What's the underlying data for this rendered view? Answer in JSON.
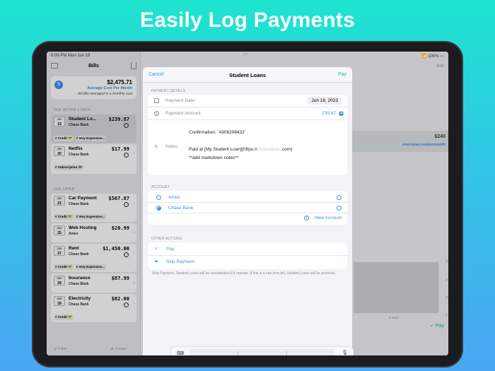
{
  "headline": "Easily Log Payments",
  "status": {
    "time": "6:09 PM",
    "date": "Mon Jun 19",
    "battery": "100%"
  },
  "sidebar": {
    "title": "Bills",
    "summary": {
      "amount": "$2,475.71",
      "caption": "Average Cost Per Month",
      "note": "All bills averaged to a monthly cost"
    },
    "sections": [
      {
        "label": "DUE WITHIN 3 DAYS",
        "bills": [
          {
            "month": "Jun",
            "day": "19",
            "name": "Student Lo...",
            "account": "Chase Bank",
            "price": "$239.87",
            "tags": [
              "# Credit 💳",
              "# Very Expensive..."
            ]
          },
          {
            "month": "Jun",
            "day": "20",
            "name": "Netflix",
            "account": "Chase Bank",
            "price": "$17.99",
            "tags": [
              "# Subscription 🎮"
            ]
          }
        ]
      },
      {
        "label": "DUE LATER",
        "bills": [
          {
            "month": "Jun",
            "day": "23",
            "name": "Car Payment",
            "account": "Chase Bank",
            "price": "$567.87",
            "tags": [
              "# Credit 💳",
              "# Very Expensive..."
            ]
          },
          {
            "month": "Jun",
            "day": "25",
            "name": "Web Hosting",
            "account": "Amex",
            "price": "$20.99",
            "tags": []
          },
          {
            "month": "Jun",
            "day": "27",
            "name": "Rent",
            "account": "Chase Bank",
            "price": "$1,450.00",
            "tags": [
              "# Credit 💳",
              "# Very Expensive..."
            ]
          },
          {
            "month": "Jun",
            "day": "29",
            "name": "Insurance",
            "account": "Chase Bank",
            "price": "$87.99",
            "tags": []
          },
          {
            "month": "Jun",
            "day": "29",
            "name": "Electricity",
            "account": "Chase Bank",
            "price": "$82.00",
            "tags": [
              "# Credit 💳"
            ]
          }
        ]
      }
    ],
    "footer": {
      "filter": "Filter",
      "create": "Create"
    }
  },
  "detail": {
    "edit": "Edit",
    "card_value": "$240",
    "card_sub": "overview.costpermonth",
    "axis": [
      "300",
      "200",
      "100",
      "0"
    ],
    "axis_date": "6-2023",
    "pay": "Pay"
  },
  "modal": {
    "cancel": "Cancel",
    "title": "Student Loans",
    "pay": "Pay",
    "payment_details_label": "PAYMENT DETAILS",
    "payment_date_label": "Payment Date",
    "payment_date_value": "Jun 19, 2023",
    "payment_amount_label": "Payment Amount",
    "payment_amount_value": "239.87",
    "notes_label": "Notes",
    "notes_line1": "Confirmation: `4308208432`",
    "notes_line2": "Paid at [My Student Loan](https://",
    "notes_line2_tail": ".com)",
    "notes_line3": "**add markdown notes**",
    "account_label": "ACCOUNT",
    "accounts": [
      "Amex",
      "Chase Bank"
    ],
    "new_account": "New Account",
    "other_actions_label": "OTHER ACTIONS",
    "action_pay": "Pay",
    "action_skip": "Skip Payment",
    "footnote": "Skip Payment. Student Loans will be rescheduled if it repeats. If this is a one time bill, Student Loans will be archived."
  },
  "colors": {
    "accent": "#3e8ef7",
    "pay_green": "#2bb673",
    "headline_bg": "#1ee5cf"
  }
}
